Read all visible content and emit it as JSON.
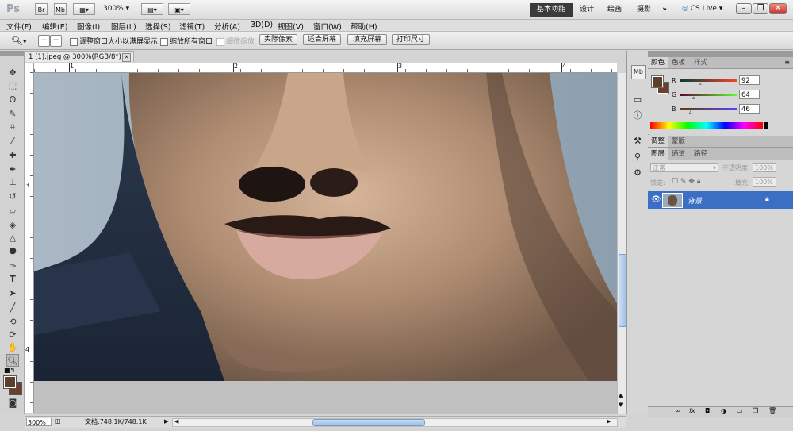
{
  "app": {
    "logo": "Ps"
  },
  "topbar": {
    "zoom_value": "300%",
    "workspaces": [
      {
        "label": "基本功能",
        "active": true
      },
      {
        "label": "设计",
        "active": false
      },
      {
        "label": "绘画",
        "active": false
      },
      {
        "label": "摄影",
        "active": false
      }
    ],
    "more": "»",
    "cs_live": "CS Live"
  },
  "menu": [
    "文件(F)",
    "编辑(E)",
    "图像(I)",
    "图层(L)",
    "选择(S)",
    "滤镜(T)",
    "分析(A)",
    "3D(D)",
    "视图(V)",
    "窗口(W)",
    "帮助(H)"
  ],
  "options": {
    "resize_windows_label": "调整窗口大小以满屏显示",
    "zoom_all_label": "缩放所有窗口",
    "scrubby_label": "细微缩放",
    "actual_pixels": "实际像素",
    "fit_screen": "适合屏幕",
    "fill_screen": "填充屏幕",
    "print_size": "打印尺寸"
  },
  "document": {
    "tab_title": "1 (1).jpeg @ 300%(RGB/8*)",
    "ruler_h_labels": [
      "1",
      "2",
      "3",
      "4"
    ],
    "ruler_v_labels": [
      "3",
      "4"
    ]
  },
  "status": {
    "zoom": "300%",
    "doc_info": "文档:748.1K/748.1K"
  },
  "color_panel": {
    "tabs": [
      "颜色",
      "色板",
      "样式"
    ],
    "r_label": "R",
    "r_value": "92",
    "g_label": "G",
    "g_value": "64",
    "b_label": "B",
    "b_value": "46",
    "foreground_color": "#5c402e"
  },
  "adjust_panel": {
    "tabs": [
      "调整",
      "蒙版"
    ]
  },
  "layers_panel": {
    "tabs": [
      "图层",
      "通道",
      "路径"
    ],
    "blend_mode": "正常",
    "opacity_label": "不透明度:",
    "opacity_value": "100%",
    "lock_label": "锁定:",
    "fill_label": "填充:",
    "fill_value": "100%",
    "layer_name": "背景",
    "selected_color": "#3a6fc4"
  }
}
